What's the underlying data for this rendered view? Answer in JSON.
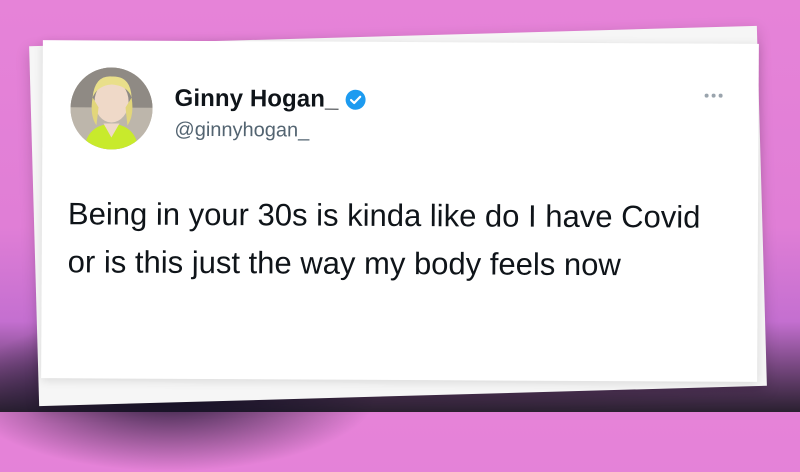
{
  "tweet": {
    "display_name": "Ginny Hogan_",
    "handle": "@ginnyhogan_",
    "verified": true,
    "text": "Being in your 30s is kinda like do I have Covid or is this just the way my body feels now",
    "avatar_icon": "profile-photo",
    "more_icon": "more-options-icon"
  },
  "colors": {
    "background": "#e683d8",
    "verified_badge": "#1d9bf0",
    "text_primary": "#0f1419",
    "text_secondary": "#536471"
  }
}
